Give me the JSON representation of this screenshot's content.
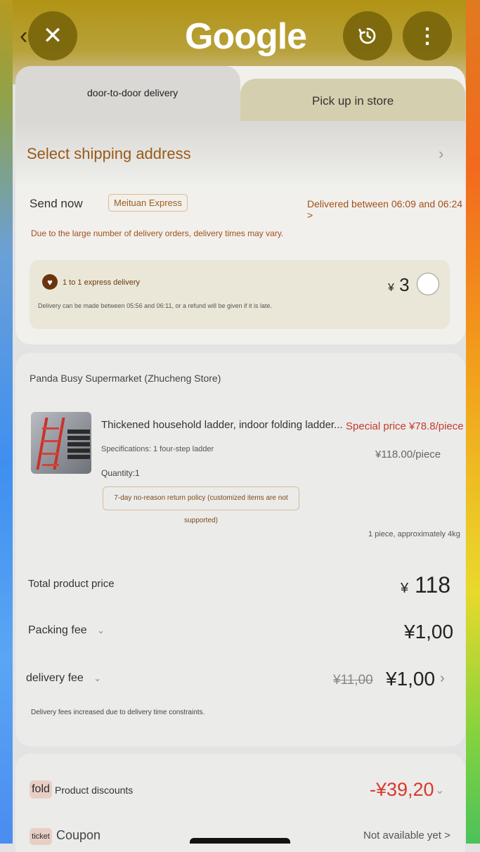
{
  "header": {
    "back_icon": "chevron-left-icon",
    "close_icon": "close-icon",
    "logo_text": "Google",
    "history_icon": "history-icon",
    "more_icon": "more-vert-icon"
  },
  "tabs": [
    {
      "label": "door-to-door delivery",
      "active": true
    },
    {
      "label": "Pick up in store",
      "active": false
    }
  ],
  "shipping": {
    "title": "Select shipping address",
    "send_now": "Send now",
    "courier_badge": "Meituan Express",
    "delivery_window": "Delivered between 06:09 and 06:24 >",
    "vary_note": "Due to the large number of delivery orders, delivery times may vary."
  },
  "express": {
    "title": "1 to 1 express delivery",
    "subtitle": "Delivery can be made between 05:56 and 06:11, or a refund will be given if it is late.",
    "currency": "¥",
    "price": "3",
    "selected": false
  },
  "store": {
    "name": "Panda Busy Supermarket (Zhucheng Store)"
  },
  "product": {
    "name": "Thickened household ladder, indoor folding ladder...",
    "spec": "Specifications: 1 four-step ladder",
    "quantity": "Quantity:1",
    "policy": "7-day no-reason return policy (customized items are not supported)",
    "special_price": "Special price ¥78.8/piece",
    "original_price": "¥118.00/piece",
    "weight": "1 piece, approximately 4kg"
  },
  "fees": {
    "total_label": "Total product price",
    "total_currency": "¥",
    "total_value": "118",
    "packing_label": "Packing fee",
    "packing_value": "¥1,00",
    "delivery_label": "delivery fee",
    "delivery_old": "¥11,00",
    "delivery_new": "¥1,00",
    "delivery_note": "Delivery fees increased due to delivery time constraints."
  },
  "discounts": {
    "fold_icon_text": "fold",
    "product_discounts_label": "Product discounts",
    "product_discounts_value": "-¥39,20",
    "ticket_icon_text": "ticket",
    "coupon_label": "Coupon",
    "coupon_value": "Not available yet >"
  },
  "colors": {
    "header_bg": "#b19314",
    "accent_brown": "#9a5a18",
    "price_red": "#d8392b"
  }
}
